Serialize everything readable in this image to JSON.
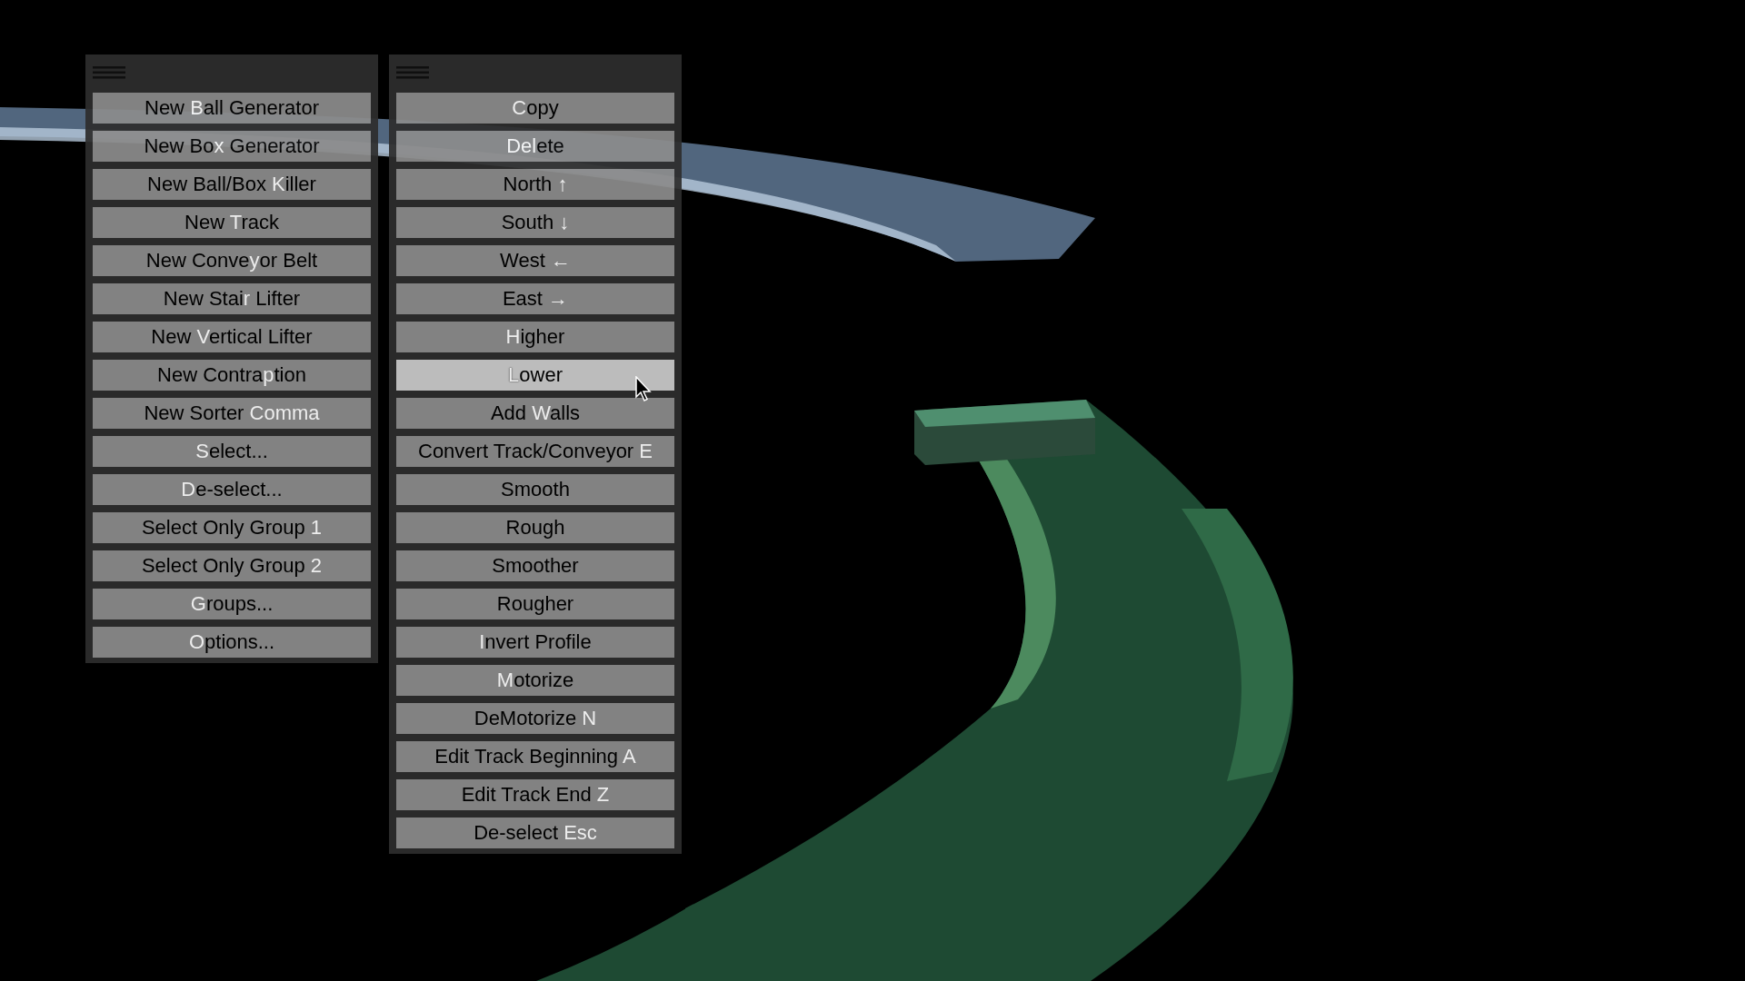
{
  "menus": [
    {
      "items": [
        {
          "before": "New ",
          "key": "B",
          "after": "all Generator",
          "highlighted": false
        },
        {
          "before": "New Bo",
          "key": "x",
          "after": " Generator",
          "highlighted": false
        },
        {
          "before": "New Ball/Box ",
          "key": "K",
          "after": "iller",
          "highlighted": false
        },
        {
          "before": "New ",
          "key": "T",
          "after": "rack",
          "highlighted": false
        },
        {
          "before": "New Conve",
          "key": "y",
          "after": "or Belt",
          "highlighted": false
        },
        {
          "before": "New Stai",
          "key": "r",
          "after": " Lifter",
          "highlighted": false
        },
        {
          "before": "New ",
          "key": "V",
          "after": "ertical Lifter",
          "highlighted": false
        },
        {
          "before": "New Contra",
          "key": "p",
          "after": "tion",
          "highlighted": false
        },
        {
          "before": "New Sorter ",
          "key": "Comma",
          "highlighted": false
        },
        {
          "key": "S",
          "after": "elect...",
          "highlighted": false
        },
        {
          "key": "D",
          "after": "e-select...",
          "highlighted": false
        },
        {
          "before": "Select Only Group ",
          "key": "1",
          "highlighted": false
        },
        {
          "before": "Select Only Group ",
          "key": "2",
          "highlighted": false
        },
        {
          "key": "G",
          "after": "roups...",
          "highlighted": false
        },
        {
          "key": "O",
          "after": "ptions...",
          "highlighted": false
        }
      ]
    },
    {
      "items": [
        {
          "key": "C",
          "after": "opy",
          "highlighted": false
        },
        {
          "key": "Del",
          "after": "ete",
          "highlighted": false
        },
        {
          "before": "North ",
          "key": "↑",
          "highlighted": false
        },
        {
          "before": "South ",
          "key": "↓",
          "highlighted": false
        },
        {
          "before": "West ",
          "key": "←",
          "highlighted": false
        },
        {
          "before": "East ",
          "key": "→",
          "highlighted": false
        },
        {
          "key": "H",
          "after": "igher",
          "highlighted": false
        },
        {
          "key": "L",
          "after": "ower",
          "highlighted": true
        },
        {
          "before": "Add ",
          "key": "W",
          "after": "alls",
          "highlighted": false
        },
        {
          "before": "Convert Track/Conveyor ",
          "key": "E",
          "highlighted": false
        },
        {
          "before": "Smooth",
          "highlighted": false
        },
        {
          "before": "Rough",
          "highlighted": false
        },
        {
          "before": "Smoother",
          "highlighted": false
        },
        {
          "before": "Rougher",
          "highlighted": false
        },
        {
          "key": "I",
          "after": "nvert Profile",
          "highlighted": false
        },
        {
          "key": "M",
          "after": "otorize",
          "highlighted": false
        },
        {
          "before": "DeMotorize ",
          "key": "N",
          "highlighted": false
        },
        {
          "before": "Edit Track Beginning ",
          "key": "A",
          "highlighted": false
        },
        {
          "before": "Edit Track End ",
          "key": "Z",
          "highlighted": false
        },
        {
          "before": "De-select ",
          "key": "Esc",
          "highlighted": false
        }
      ]
    }
  ]
}
